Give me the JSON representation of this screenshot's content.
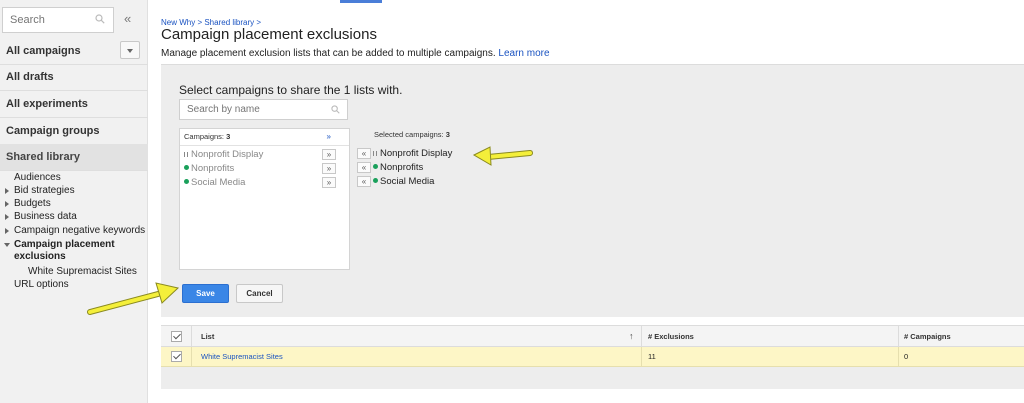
{
  "sidebar": {
    "search_placeholder": "Search",
    "collapse_glyph": "«",
    "nav": [
      {
        "label": "All campaigns"
      },
      {
        "label": "All drafts"
      },
      {
        "label": "All experiments"
      },
      {
        "label": "Campaign groups"
      },
      {
        "label": "Shared library"
      }
    ],
    "shared_items": [
      {
        "label": "Audiences"
      },
      {
        "label": "Bid strategies"
      },
      {
        "label": "Budgets"
      },
      {
        "label": "Business data"
      },
      {
        "label": "Campaign negative keywords"
      },
      {
        "label": "Campaign placement exclusions"
      },
      {
        "label": "White Supremacist Sites"
      },
      {
        "label": "URL options"
      }
    ]
  },
  "main": {
    "breadcrumb": "New Why > Shared library >",
    "title": "Campaign placement exclusions",
    "description": "Manage placement exclusion lists that can be added to multiple campaigns.",
    "learn_more": "Learn more"
  },
  "share_panel": {
    "heading": "Select campaigns to share the 1 lists with.",
    "search_placeholder": "Search by name",
    "campaigns_label": "Campaigns:",
    "campaigns_count": "3",
    "add_all_glyph": "»",
    "add_glyph": "»",
    "remove_glyph": "«",
    "selected_label": "Selected campaigns:",
    "selected_count": "3",
    "available": [
      {
        "name": "Nonprofit Display",
        "status": "paused"
      },
      {
        "name": "Nonprofits",
        "status": "enabled"
      },
      {
        "name": "Social Media",
        "status": "enabled"
      }
    ],
    "selected": [
      {
        "name": "Nonprofit Display",
        "status": "paused"
      },
      {
        "name": "Nonprofits",
        "status": "enabled"
      },
      {
        "name": "Social Media",
        "status": "enabled"
      }
    ],
    "save_label": "Save",
    "cancel_label": "Cancel"
  },
  "table": {
    "headers": {
      "list": "List",
      "exclusions": "# Exclusions",
      "campaigns": "# Campaigns"
    },
    "sort_glyph": "↑",
    "rows": [
      {
        "list": "White Supremacist Sites",
        "exclusions": "11",
        "campaigns": "0"
      }
    ]
  },
  "colors": {
    "accent_blue": "#3a86e6",
    "link_blue": "#1a53c1",
    "enabled_green": "#1aa05b",
    "highlight_yellow": "#fdf6c6",
    "annotation_arrow": "#f4ef3a"
  }
}
